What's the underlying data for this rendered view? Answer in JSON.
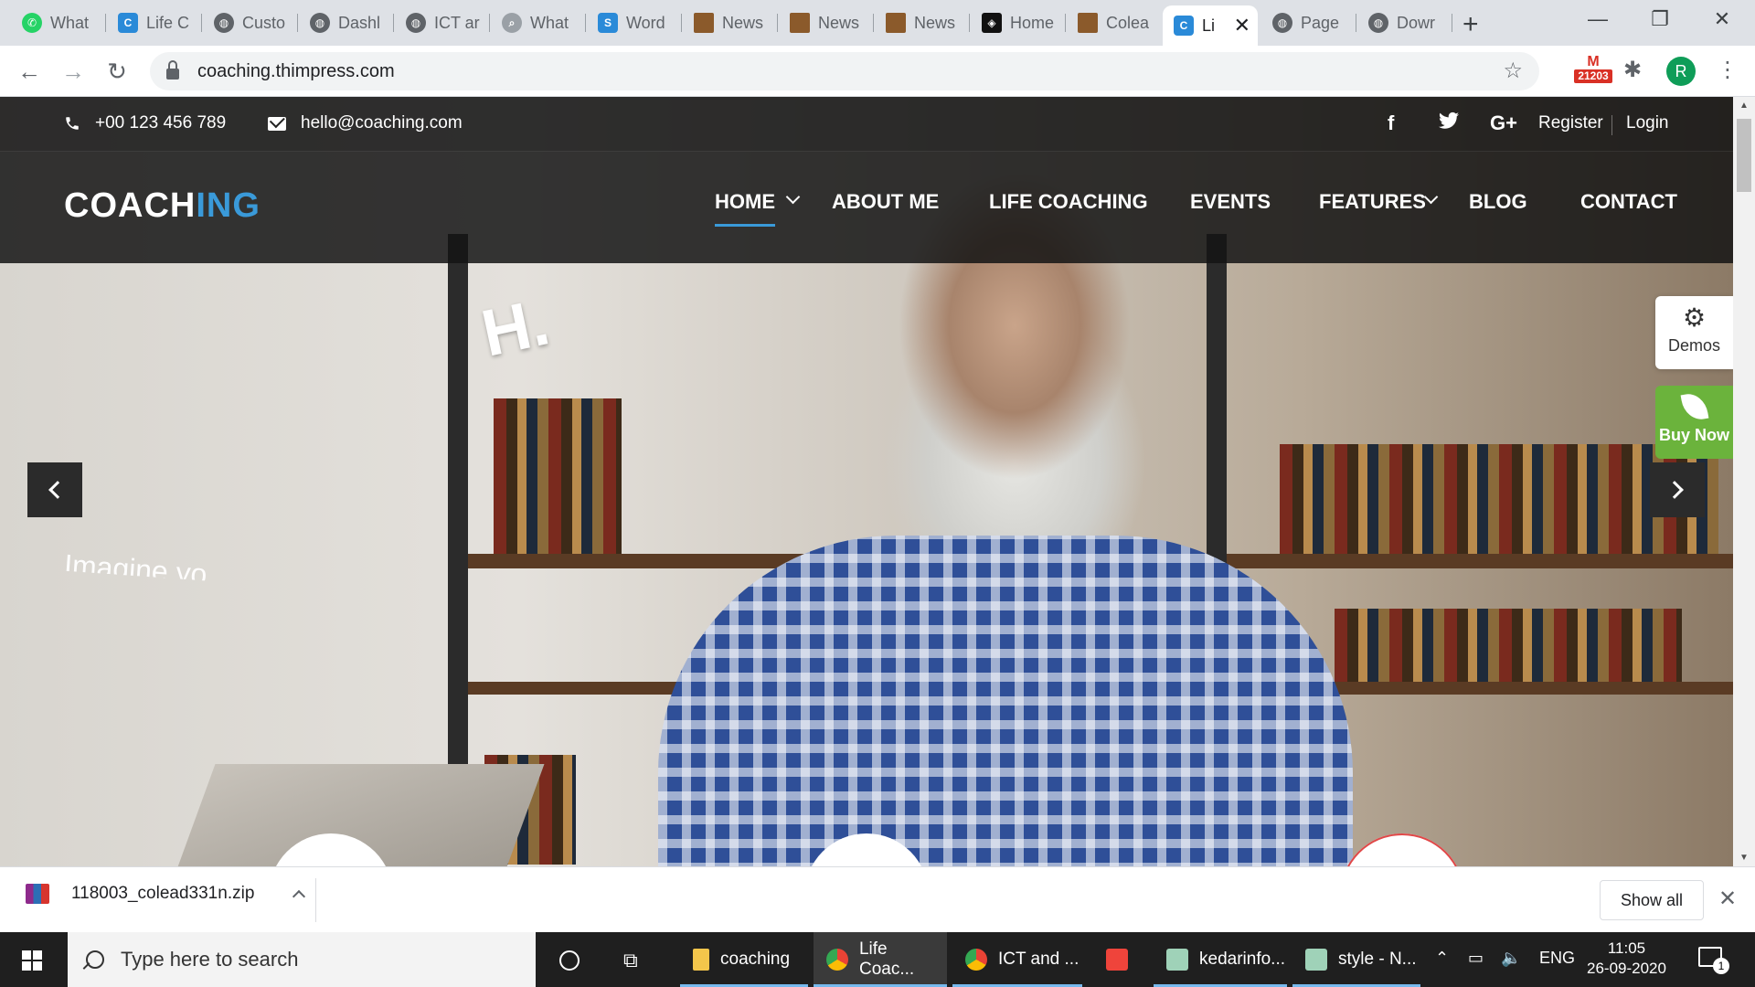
{
  "browser": {
    "tabs": [
      {
        "title": "What",
        "favicon_color": "#25d366",
        "favicon": "whatsapp-icon"
      },
      {
        "title": "Life C",
        "favicon_color": "#2a8ad8",
        "favicon": "c-icon"
      },
      {
        "title": "Custo",
        "favicon_color": "#5f6368",
        "favicon": "globe-icon"
      },
      {
        "title": "Dashl",
        "favicon_color": "#5f6368",
        "favicon": "globe-icon"
      },
      {
        "title": "ICT ar",
        "favicon_color": "#5f6368",
        "favicon": "globe-icon"
      },
      {
        "title": "What",
        "favicon_color": "#9aa0a6",
        "favicon": "search-doc-icon"
      },
      {
        "title": "Word",
        "favicon_color": "#2a8ad8",
        "favicon": "s-icon"
      },
      {
        "title": "News",
        "favicon_color": "#8b5a2b",
        "favicon": "news-icon"
      },
      {
        "title": "News",
        "favicon_color": "#8b5a2b",
        "favicon": "news-icon"
      },
      {
        "title": "News",
        "favicon_color": "#8b5a2b",
        "favicon": "news-icon"
      },
      {
        "title": "Home",
        "favicon_color": "#111111",
        "favicon": "home-logo-icon"
      },
      {
        "title": "Colea",
        "favicon_color": "#8b5a2b",
        "favicon": "news-icon"
      },
      {
        "title": "Li",
        "favicon_color": "#2a8ad8",
        "favicon": "c-icon",
        "active": true
      },
      {
        "title": "Page",
        "favicon_color": "#5f6368",
        "favicon": "globe-icon"
      },
      {
        "title": "Dowr",
        "favicon_color": "#5f6368",
        "favicon": "globe-icon"
      }
    ],
    "url": "coaching.thimpress.com",
    "mail_badge": "21203",
    "profile_initial": "R"
  },
  "site": {
    "topbar": {
      "phone": "+00 123 456 789",
      "email": "hello@coaching.com",
      "social": [
        "f",
        "t",
        "G+"
      ],
      "register": "Register",
      "login": "Login"
    },
    "logo": {
      "part1": "COACH",
      "part2": "ING"
    },
    "accent_color": "#3a9ad9",
    "menu": [
      {
        "label": "HOME",
        "active": true,
        "dropdown": true
      },
      {
        "label": "ABOUT ME"
      },
      {
        "label": "LIFE COACHING"
      },
      {
        "label": "EVENTS"
      },
      {
        "label": "FEATURES",
        "dropdown": true
      },
      {
        "label": "BLOG"
      },
      {
        "label": "CONTACT"
      }
    ],
    "hero": {
      "headline": "H.",
      "subline": "Imagine yo..."
    },
    "side_panel": {
      "demos": "Demos",
      "buy_now": "Buy Now",
      "buy_color": "#6bb33c"
    }
  },
  "downloads": {
    "file": "118003_colead331n.zip",
    "show_all": "Show all"
  },
  "taskbar": {
    "search_placeholder": "Type here to search",
    "apps": [
      {
        "label": "coaching"
      },
      {
        "label": "Life Coac..."
      },
      {
        "label": "ICT and ..."
      },
      {
        "label": "kedarinfo..."
      },
      {
        "label": "style - N..."
      }
    ],
    "language": "ENG",
    "time": "11:05",
    "date": "26-09-2020",
    "notification_count": "1"
  }
}
